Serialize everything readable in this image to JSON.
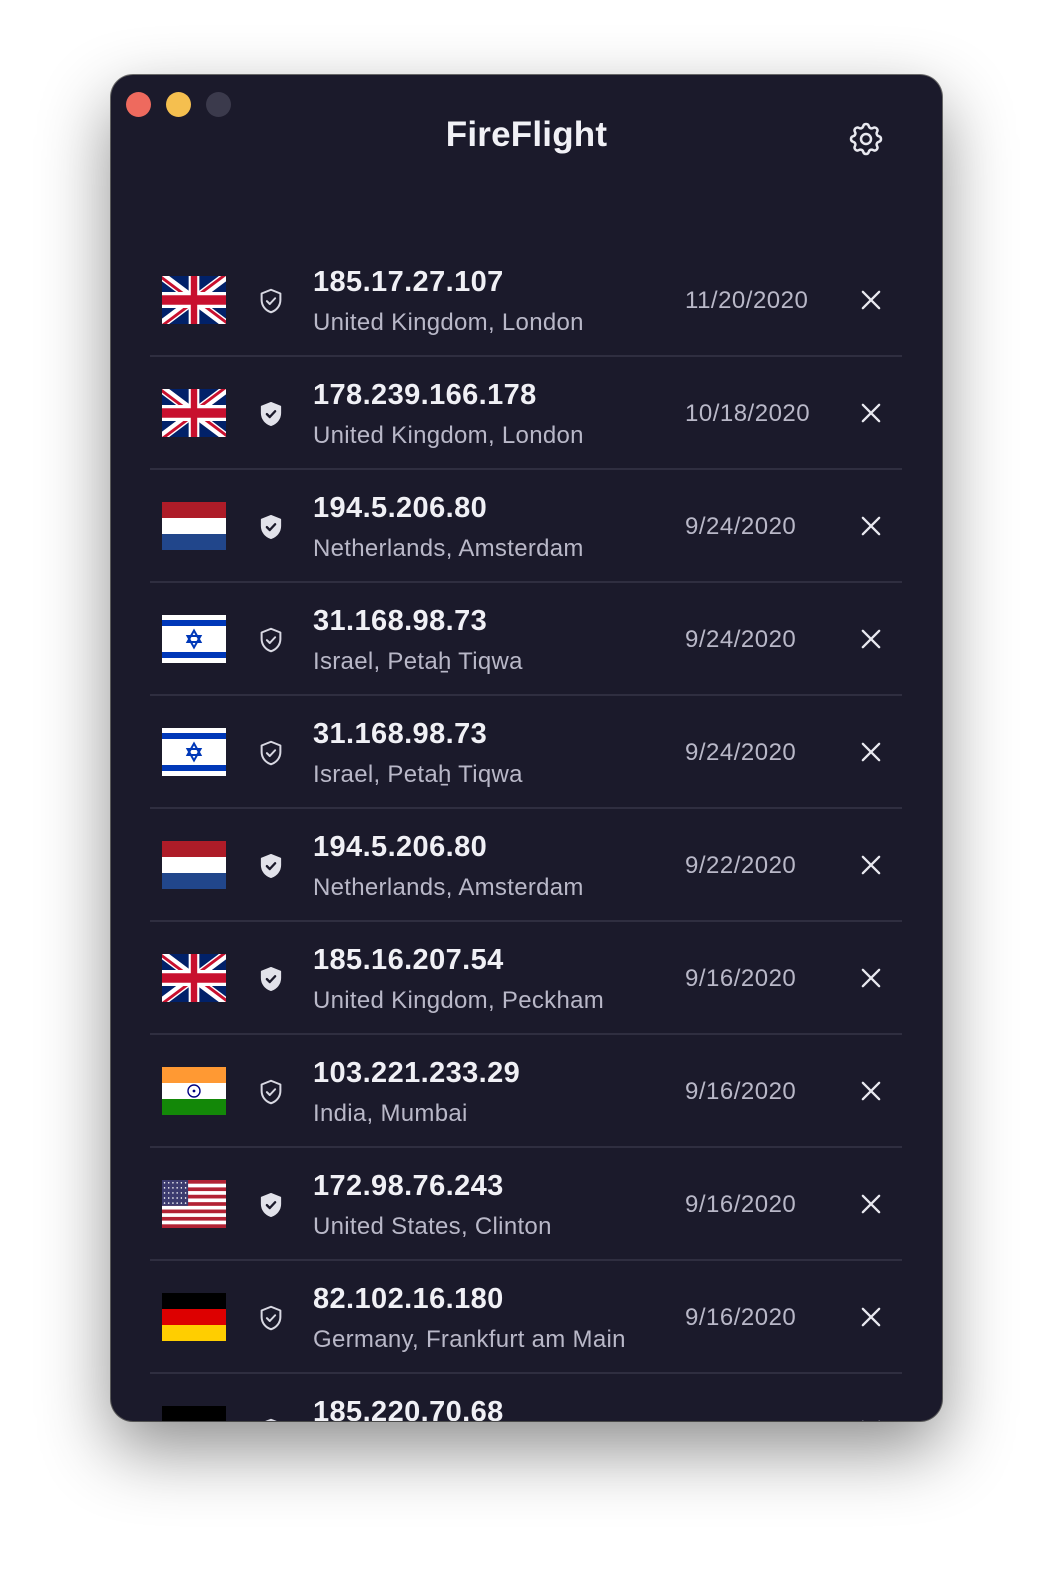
{
  "app": {
    "title": "FireFlight",
    "settings_icon": "gear-icon"
  },
  "colors": {
    "window_bg": "#1b1a2b",
    "divider": "#2f2e40",
    "text_primary": "#f0f0f5",
    "text_secondary": "#b9b8c8",
    "close": "#ee6a5e",
    "minimize": "#f5bf4f",
    "maximize_inactive": "#3b3a4c"
  },
  "connections": [
    {
      "flag": "gb",
      "shield": "outline",
      "ip": "185.17.27.107",
      "location": "United Kingdom, London",
      "date": "11/20/2020"
    },
    {
      "flag": "gb",
      "shield": "filled",
      "ip": "178.239.166.178",
      "location": "United Kingdom, London",
      "date": "10/18/2020"
    },
    {
      "flag": "nl",
      "shield": "filled",
      "ip": "194.5.206.80",
      "location": "Netherlands, Amsterdam",
      "date": "9/24/2020"
    },
    {
      "flag": "il",
      "shield": "outline",
      "ip": "31.168.98.73",
      "location": "Israel, Petah̠ Tiqwa",
      "date": "9/24/2020"
    },
    {
      "flag": "il",
      "shield": "outline",
      "ip": "31.168.98.73",
      "location": "Israel, Petah̠ Tiqwa",
      "date": "9/24/2020"
    },
    {
      "flag": "nl",
      "shield": "filled",
      "ip": "194.5.206.80",
      "location": "Netherlands, Amsterdam",
      "date": "9/22/2020"
    },
    {
      "flag": "gb",
      "shield": "filled",
      "ip": "185.16.207.54",
      "location": "United Kingdom, Peckham",
      "date": "9/16/2020"
    },
    {
      "flag": "in",
      "shield": "outline",
      "ip": "103.221.233.29",
      "location": "India, Mumbai",
      "date": "9/16/2020"
    },
    {
      "flag": "us",
      "shield": "filled",
      "ip": "172.98.76.243",
      "location": "United States, Clinton",
      "date": "9/16/2020"
    },
    {
      "flag": "de",
      "shield": "outline",
      "ip": "82.102.16.180",
      "location": "Germany, Frankfurt am Main",
      "date": "9/16/2020"
    },
    {
      "flag": "de",
      "shield": "outline",
      "ip": "185.220.70.68",
      "location": "",
      "date": ""
    }
  ]
}
